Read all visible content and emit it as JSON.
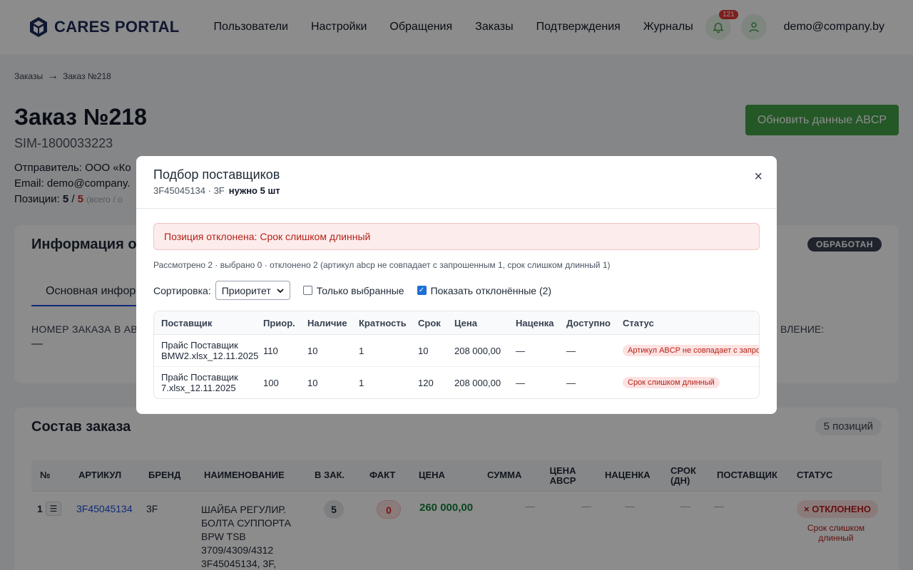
{
  "header": {
    "logo_text": "CARES PORTAL",
    "nav": [
      "Пользователи",
      "Настройки",
      "Обращения",
      "Заказы",
      "Подтверждения",
      "Журналы"
    ],
    "notifications_count": "121",
    "user_email": "demo@company.by"
  },
  "breadcrumb": {
    "parent": "Заказы",
    "arrow": "→",
    "current": "Заказ №218"
  },
  "order": {
    "title": "Заказ №218",
    "sim": "SIM-1800033223",
    "sender_label": "Отправитель:",
    "sender_value": "ООО «Ко",
    "email_label": "Email:",
    "email_value": "demo@company.",
    "positions_label": "Позиции:",
    "positions_done": "5",
    "positions_sep": " / ",
    "positions_total": "5",
    "positions_note": "(всего / о",
    "refresh_button": "Обновить данные ABCP"
  },
  "info_card": {
    "title": "Информация о з",
    "status": "ОБРАБОТАН",
    "tab": "Основная информ",
    "field_label": "НОМЕР ЗАКАЗА В АВ",
    "field_value": "—",
    "field_label_right": "ВЛЕНИЕ:"
  },
  "composition": {
    "title": "Состав заказа",
    "count": "5 позиций",
    "columns": [
      "№",
      "АРТИКУЛ",
      "БРЕНД",
      "НАИМЕНОВАНИЕ",
      "В ЗАК.",
      "ФАКТ",
      "ЦЕНА",
      "СУММА",
      "ЦЕНА ABCP",
      "НАЦЕНКА",
      "СРОК (ДН)",
      "ПОСТАВЩИК",
      "СТАТУС"
    ],
    "row": {
      "num": "1",
      "article": "3F45045134",
      "brand": "3F",
      "name": "ШАЙБА РЕГУЛИР. БОЛТА СУППОРТА BPW TSB 3709/4309/4312 3F45045134, 3F,",
      "ordered": "5",
      "fact": "0",
      "price": "260 000,00",
      "sum": "—",
      "price_abcp": "—",
      "markup": "—",
      "term": "—",
      "supplier": "—",
      "status": "× ОТКЛОНЕНО",
      "status_note": "Срок слишком длинный"
    }
  },
  "modal": {
    "title": "Подбор поставщиков",
    "subtitle": "3F45045134 · 3F",
    "need": "нужно 5 шт",
    "close": "×",
    "alert": "Позиция отклонена: Срок слишком длинный",
    "summary": "Рассмотрено 2 · выбрано 0 · отклонено 2 (артикул abcp не совпадает с запрошенным 1, срок слишком длинный 1)",
    "sort_label": "Сортировка:",
    "sort_value": "Приоритет",
    "only_selected": "Только выбранные",
    "show_rejected": "Показать отклонённые (2)",
    "columns": [
      "Поставщик",
      "Приор.",
      "Наличие",
      "Кратность",
      "Срок",
      "Цена",
      "Наценка",
      "Доступно",
      "Статус"
    ],
    "rows": [
      {
        "supplier": "Прайс Поставщик BMW2.xlsx_12.11.2025",
        "priority": "110",
        "stock": "10",
        "multiple": "1",
        "term": "10",
        "price": "208 000,00",
        "markup": "—",
        "available": "—",
        "status": "Артикул ABCP не совпадает с запро"
      },
      {
        "supplier": "Прайс Поставщик 7.xlsx_12.11.2025",
        "priority": "100",
        "stock": "10",
        "multiple": "1",
        "term": "120",
        "price": "208 000,00",
        "markup": "—",
        "available": "—",
        "status": "Срок слишком длинный"
      }
    ]
  }
}
